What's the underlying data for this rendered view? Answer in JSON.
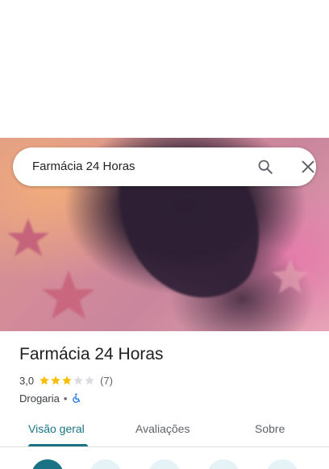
{
  "search": {
    "query": "Farmácia 24 Horas",
    "search_icon": "search-icon",
    "close_icon": "close-icon"
  },
  "place": {
    "name": "Farmácia 24 Horas",
    "rating": "3,0",
    "rating_value": 3,
    "rating_max": 5,
    "review_count": "(7)",
    "category": "Drogaria",
    "separator": "•",
    "accessibility_icon": "wheelchair-icon"
  },
  "tabs": [
    {
      "label": "Visão geral",
      "active": true
    },
    {
      "label": "Avaliações",
      "active": false
    },
    {
      "label": "Sobre",
      "active": false
    }
  ],
  "colors": {
    "accent": "#1a7384",
    "star": "#fbbc04",
    "star_empty": "#dadce0",
    "access_icon": "#1a73e8"
  }
}
